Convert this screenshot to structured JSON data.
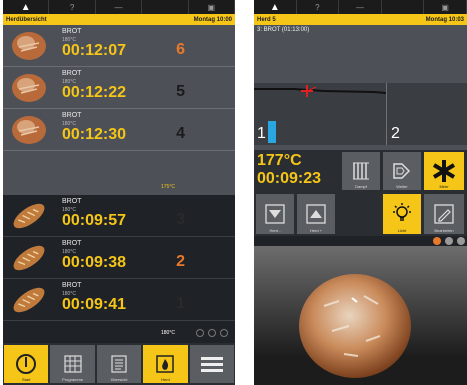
{
  "left": {
    "title": "Herdübersicht",
    "clock": "Montag 10:00",
    "upper_chamber_temp": "175°C",
    "lower_chamber_temp": "180°C",
    "rows": [
      {
        "product": "BROT",
        "temp": "180°C",
        "time": "00:12:07",
        "slot": "6",
        "slot_color": "#e8792b",
        "img": "round"
      },
      {
        "product": "BROT",
        "temp": "180°C",
        "time": "00:12:22",
        "slot": "5",
        "slot_color": "#1b1b1b",
        "img": "round"
      },
      {
        "product": "BROT",
        "temp": "180°C",
        "time": "00:12:30",
        "slot": "4",
        "slot_color": "#1b1b1b",
        "img": "round"
      },
      {
        "product": "BROT",
        "temp": "180°C",
        "time": "00:09:57",
        "slot": "3",
        "slot_color": "#2a2a2a",
        "img": "long"
      },
      {
        "product": "BROT",
        "temp": "180°C",
        "time": "00:09:38",
        "slot": "2",
        "slot_color": "#e8792b",
        "img": "long"
      },
      {
        "product": "BROT",
        "temp": "180°C",
        "time": "00:09:41",
        "slot": "1",
        "slot_color": "#2a2a2a",
        "img": "long"
      }
    ],
    "nav": [
      {
        "icon": "power-icon",
        "label": "Start",
        "active": true
      },
      {
        "icon": "grid-icon",
        "label": "Programme",
        "active": false
      },
      {
        "icon": "list-icon",
        "label": "Übersicht",
        "active": false
      },
      {
        "icon": "flame-icon",
        "label": "Herd",
        "active": true
      },
      {
        "icon": "menu-icon",
        "label": "",
        "active": false
      }
    ]
  },
  "right": {
    "title": "Herd 5",
    "clock": "Montag 10:03",
    "phase": "3: BROT (01:13:00)",
    "chamber_1": "1",
    "chamber_2": "2",
    "temp": "177°C",
    "time": "00:09:23",
    "buttons": {
      "steam": "Dampf",
      "next": "Weiter",
      "star": "Mehr",
      "down": "Herd -",
      "up": "Herd +",
      "light": "Licht",
      "edit": "Bearbeiten"
    },
    "icon_colors": {
      "accent": "#f5c518",
      "orange": "#e8792b",
      "blue": "#2aa7e0",
      "red": "#e02020"
    }
  }
}
